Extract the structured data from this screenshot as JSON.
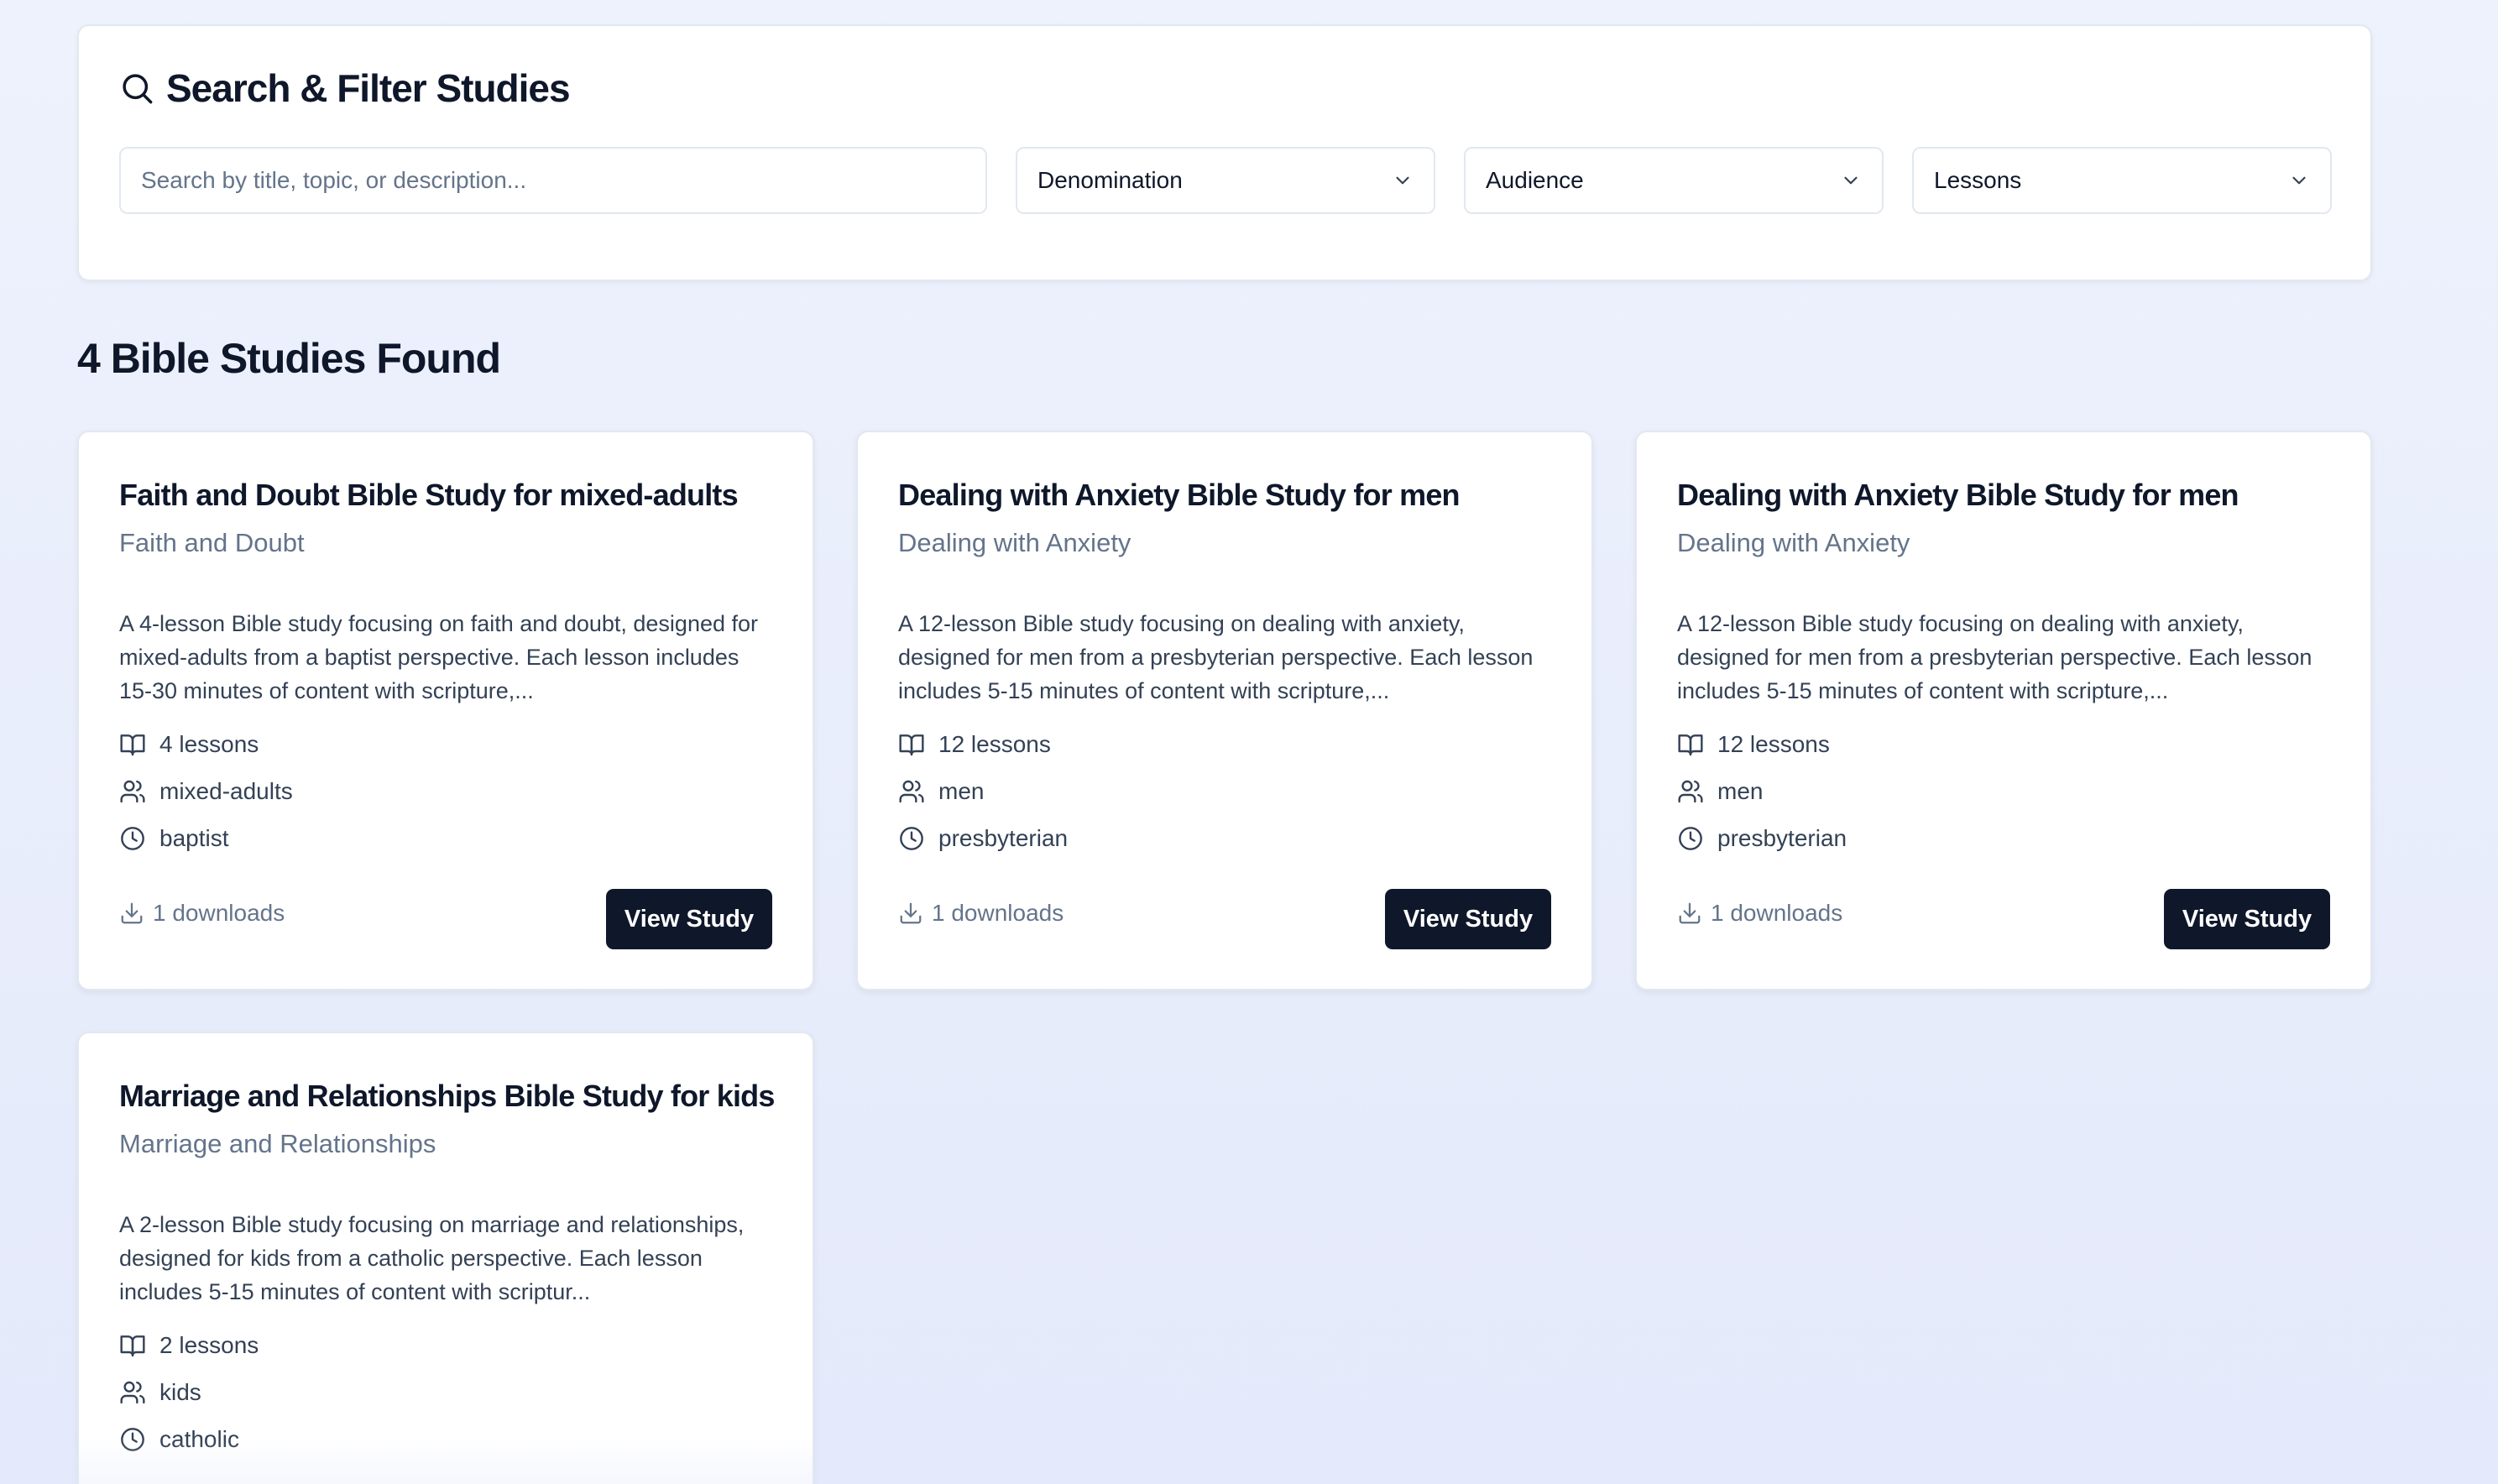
{
  "filters": {
    "title": "Search & Filter Studies",
    "search_placeholder": "Search by title, topic, or description...",
    "selects": [
      {
        "label": "Denomination"
      },
      {
        "label": "Audience"
      },
      {
        "label": "Lessons"
      }
    ]
  },
  "results": {
    "heading": "4 Bible Studies Found"
  },
  "studies": [
    {
      "title": "Faith and Doubt Bible Study for mixed-adults",
      "topic": "Faith and Doubt",
      "description": "A 4-lesson Bible study focusing on faith and doubt, designed for mixed-adults from a baptist perspective. Each lesson includes 15-30 minutes of content with scripture,...",
      "lessons": "4 lessons",
      "audience": "mixed-adults",
      "denomination": "baptist",
      "downloads": "1 downloads",
      "button": "View Study"
    },
    {
      "title": "Dealing with Anxiety Bible Study for men",
      "topic": "Dealing with Anxiety",
      "description": "A 12-lesson Bible study focusing on dealing with anxiety, designed for men from a presbyterian perspective. Each lesson includes 5-15 minutes of content with scripture,...",
      "lessons": "12 lessons",
      "audience": "men",
      "denomination": "presbyterian",
      "downloads": "1 downloads",
      "button": "View Study"
    },
    {
      "title": "Dealing with Anxiety Bible Study for men",
      "topic": "Dealing with Anxiety",
      "description": "A 12-lesson Bible study focusing on dealing with anxiety, designed for men from a presbyterian perspective. Each lesson includes 5-15 minutes of content with scripture,...",
      "lessons": "12 lessons",
      "audience": "men",
      "denomination": "presbyterian",
      "downloads": "1 downloads",
      "button": "View Study"
    },
    {
      "title": "Marriage and Relationships Bible Study for kids",
      "topic": "Marriage and Relationships",
      "description": "A 2-lesson Bible study focusing on marriage and relationships, designed for kids from a catholic perspective. Each lesson includes 5-15 minutes of content with scriptur...",
      "lessons": "2 lessons",
      "audience": "kids",
      "denomination": "catholic"
    }
  ],
  "icons": {
    "search": "search-icon",
    "chevron": "chevron-down-icon",
    "lessons": "book-open-icon",
    "audience": "users-icon",
    "denomination": "clock-icon",
    "downloads": "download-icon"
  },
  "colors": {
    "background": "#e8edfb",
    "card": "#ffffff",
    "button": "#0f172a",
    "muted_text": "#64748b"
  }
}
